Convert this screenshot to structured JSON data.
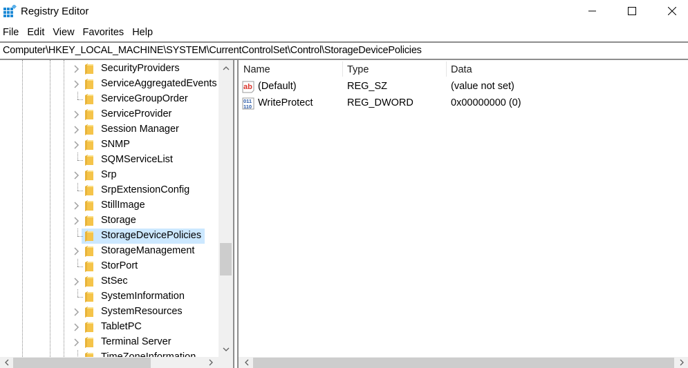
{
  "window": {
    "title": "Registry Editor",
    "controls": {
      "minimize": "minimize",
      "maximize": "maximize",
      "close": "close"
    }
  },
  "menu": [
    "File",
    "Edit",
    "View",
    "Favorites",
    "Help"
  ],
  "address": "Computer\\HKEY_LOCAL_MACHINE\\SYSTEM\\CurrentControlSet\\Control\\StorageDevicePolicies",
  "tree": {
    "items": [
      {
        "label": "SecurityProviders",
        "expandable": true,
        "selected": false
      },
      {
        "label": "ServiceAggregatedEvents",
        "expandable": true,
        "selected": false
      },
      {
        "label": "ServiceGroupOrder",
        "expandable": false,
        "selected": false
      },
      {
        "label": "ServiceProvider",
        "expandable": true,
        "selected": false
      },
      {
        "label": "Session Manager",
        "expandable": true,
        "selected": false
      },
      {
        "label": "SNMP",
        "expandable": true,
        "selected": false
      },
      {
        "label": "SQMServiceList",
        "expandable": false,
        "selected": false
      },
      {
        "label": "Srp",
        "expandable": true,
        "selected": false
      },
      {
        "label": "SrpExtensionConfig",
        "expandable": false,
        "selected": false
      },
      {
        "label": "StillImage",
        "expandable": true,
        "selected": false
      },
      {
        "label": "Storage",
        "expandable": true,
        "selected": false
      },
      {
        "label": "StorageDevicePolicies",
        "expandable": false,
        "selected": true
      },
      {
        "label": "StorageManagement",
        "expandable": true,
        "selected": false
      },
      {
        "label": "StorPort",
        "expandable": false,
        "selected": false
      },
      {
        "label": "StSec",
        "expandable": true,
        "selected": false
      },
      {
        "label": "SystemInformation",
        "expandable": false,
        "selected": false
      },
      {
        "label": "SystemResources",
        "expandable": true,
        "selected": false
      },
      {
        "label": "TabletPC",
        "expandable": true,
        "selected": false
      },
      {
        "label": "Terminal Server",
        "expandable": true,
        "selected": false
      },
      {
        "label": "TimeZoneInformation",
        "expandable": false,
        "selected": false
      }
    ]
  },
  "values": {
    "columns": [
      "Name",
      "Type",
      "Data"
    ],
    "rows": [
      {
        "icon": "string-value-icon",
        "name": "(Default)",
        "type": "REG_SZ",
        "data": "(value not set)"
      },
      {
        "icon": "binary-value-icon",
        "name": "WriteProtect",
        "type": "REG_DWORD",
        "data": "0x00000000 (0)"
      }
    ]
  },
  "colors": {
    "selection": "#cce8ff",
    "folder": "#f5c44a",
    "string_icon": "#d9342b",
    "dword_icon": "#2a5aa8",
    "app_icon": "#1e8ad6"
  }
}
